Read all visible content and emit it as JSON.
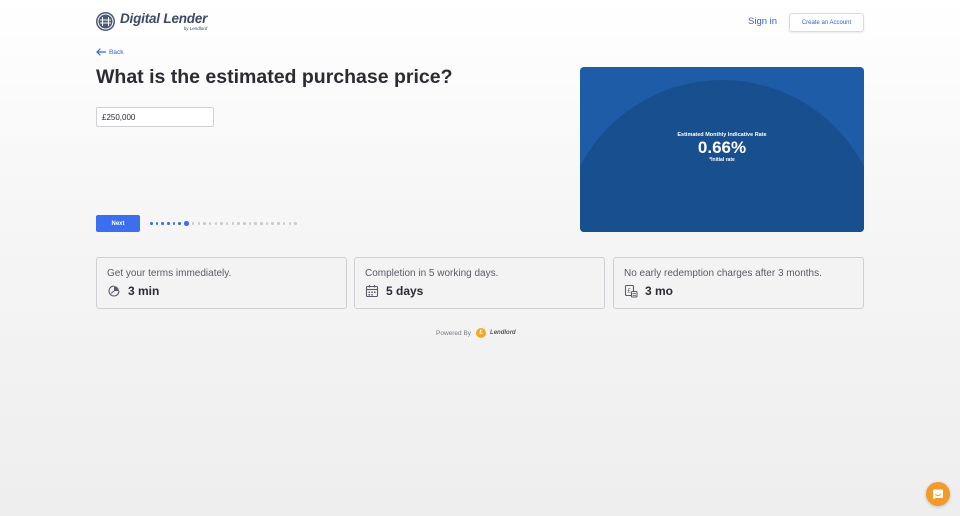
{
  "header": {
    "brand_title": "Digital Lender",
    "brand_subtitle": "by Lendlord",
    "signin_label": "Sign in",
    "create_account_label": "Create an Account"
  },
  "step": {
    "back_label": "Back",
    "question": "What is the estimated purchase price?",
    "price_value": "£250,000",
    "next_label": "Next",
    "progress": {
      "total": 26,
      "current": 6
    }
  },
  "rate_card": {
    "label": "Estimated Monthly Indicative Rate",
    "value": "0.66%",
    "note": "*Initial rate"
  },
  "features": [
    {
      "title": "Get your terms immediately.",
      "value": "3 min",
      "icon": "clock-icon"
    },
    {
      "title": "Completion in 5 working days.",
      "value": "5 days",
      "icon": "calendar-icon"
    },
    {
      "title": "No early redemption charges after 3 months.",
      "value": "3 mo",
      "icon": "pound-document-icon"
    }
  ],
  "footer": {
    "powered_by": "Powered By",
    "powered_brand": "Lendlord"
  },
  "colors": {
    "accent": "#3c6ff0",
    "link": "#2f63d6",
    "card_blue": "#1f5ca8",
    "chat_orange": "#f39a2b"
  }
}
